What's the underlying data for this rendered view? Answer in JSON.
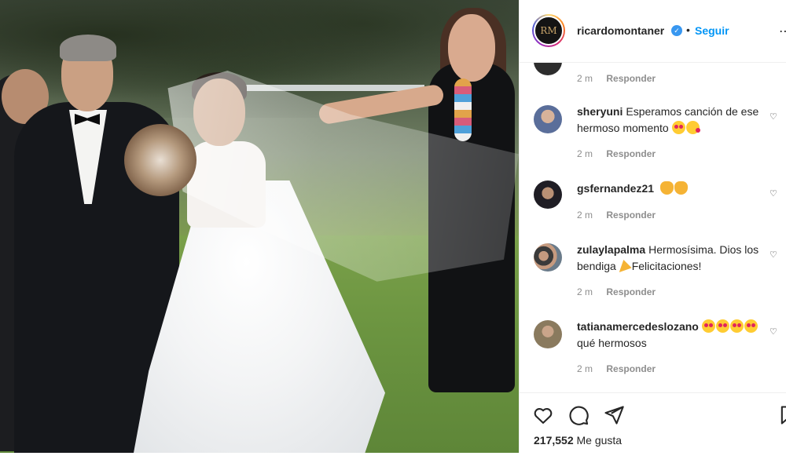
{
  "post": {
    "author": "ricardomontaner",
    "verified": true,
    "separator": "•",
    "follow_label": "Seguir",
    "avatar_text": "RM"
  },
  "comments": [
    {
      "user": "",
      "text": "",
      "time": "2 m",
      "reply": "Responder"
    },
    {
      "user": "sheryuni",
      "text": "Esperamos canción de ese hermoso momento",
      "emojis": [
        "heart-eyes-emoji",
        "kissing-heart-emoji"
      ],
      "time": "2 m",
      "reply": "Responder"
    },
    {
      "user": "gsfernandez21",
      "text": "",
      "emojis": [
        "clapping-emoji",
        "clapping-emoji"
      ],
      "time": "2 m",
      "reply": "Responder"
    },
    {
      "user": "zulaylapalma",
      "text_a": "Hermosísima. Dios los bendiga",
      "text_b": "Felicitaciones!",
      "emojis": [
        "party-popper-emoji"
      ],
      "time": "2 m",
      "reply": "Responder"
    },
    {
      "user": "tatianamercedeslozano",
      "text": "qué hermosos",
      "emojis": [
        "heart-eyes-emoji",
        "heart-eyes-emoji",
        "heart-eyes-emoji",
        "heart-eyes-emoji"
      ],
      "time": "2 m",
      "reply": "Responder"
    }
  ],
  "footer": {
    "likes_count": "217,552",
    "likes_label": "Me gusta"
  },
  "icons": {
    "like": "heart-icon",
    "comment": "comment-icon",
    "share": "paper-plane-icon",
    "save": "bookmark-icon",
    "more": "more-icon",
    "verified": "verified-badge-icon"
  },
  "colors": {
    "link": "#0095f6",
    "verified": "#3897f0",
    "meta": "#8e8e8e",
    "text": "#262626"
  }
}
